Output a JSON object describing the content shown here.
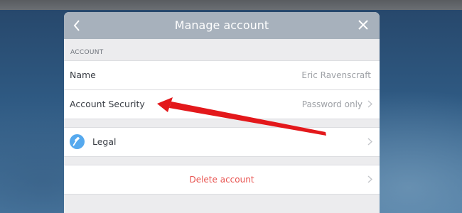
{
  "header": {
    "title": "Manage account",
    "back_icon": "chevron-left-icon",
    "close_icon": "close-icon"
  },
  "account_section": {
    "label": "ACCOUNT",
    "rows": [
      {
        "label": "Name",
        "value": "Eric Ravenscraft"
      },
      {
        "label": "Account Security",
        "value": "Password only"
      }
    ]
  },
  "legal": {
    "label": "Legal",
    "icon": "gavel-icon"
  },
  "delete": {
    "label": "Delete account"
  },
  "colors": {
    "header_bg": "#a7b1bc",
    "delete_text": "#e8524f",
    "annotation_arrow": "#e3181b",
    "legal_icon_bg": "#56a9ee"
  }
}
